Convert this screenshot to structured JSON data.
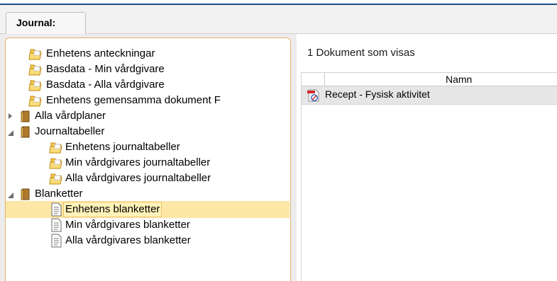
{
  "journal_tab": {
    "label": "Journal:"
  },
  "tree": {
    "items": [
      {
        "label": "Enhetens anteckningar",
        "icon": "folder-open-icon"
      },
      {
        "label": "Basdata - Min vårdgivare",
        "icon": "folder-open-icon"
      },
      {
        "label": "Basdata - Alla vårdgivare",
        "icon": "folder-open-icon"
      },
      {
        "label": "Enhetens gemensamma dokument F",
        "icon": "folder-open-icon"
      },
      {
        "label": "Alla vårdplaner",
        "icon": "book-icon",
        "expander": "collapsed"
      },
      {
        "label": "Journaltabeller",
        "icon": "book-icon",
        "expander": "expanded"
      },
      {
        "label": "Enhetens journaltabeller",
        "icon": "folder-open-icon"
      },
      {
        "label": "Min vårdgivares journaltabeller",
        "icon": "folder-open-icon"
      },
      {
        "label": "Alla vårdgivares journaltabeller",
        "icon": "folder-open-icon"
      },
      {
        "label": "Blanketter",
        "icon": "book-icon",
        "expander": "expanded"
      },
      {
        "label": "Enhetens blanketter",
        "icon": "document-icon",
        "selected": true
      },
      {
        "label": "Min vårdgivares blanketter",
        "icon": "document-icon"
      },
      {
        "label": "Alla vårdgivares blanketter",
        "icon": "document-icon"
      }
    ]
  },
  "documents": {
    "count_text": "1 Dokument som visas",
    "column_name": "Namn",
    "rows": [
      {
        "name": "Recept - Fysisk aktivitet",
        "icon": "pdf-icon"
      }
    ]
  },
  "colors": {
    "accent_line": "#1b4f86",
    "panel_border": "#e2b66a",
    "selection": "#fde7a6"
  }
}
